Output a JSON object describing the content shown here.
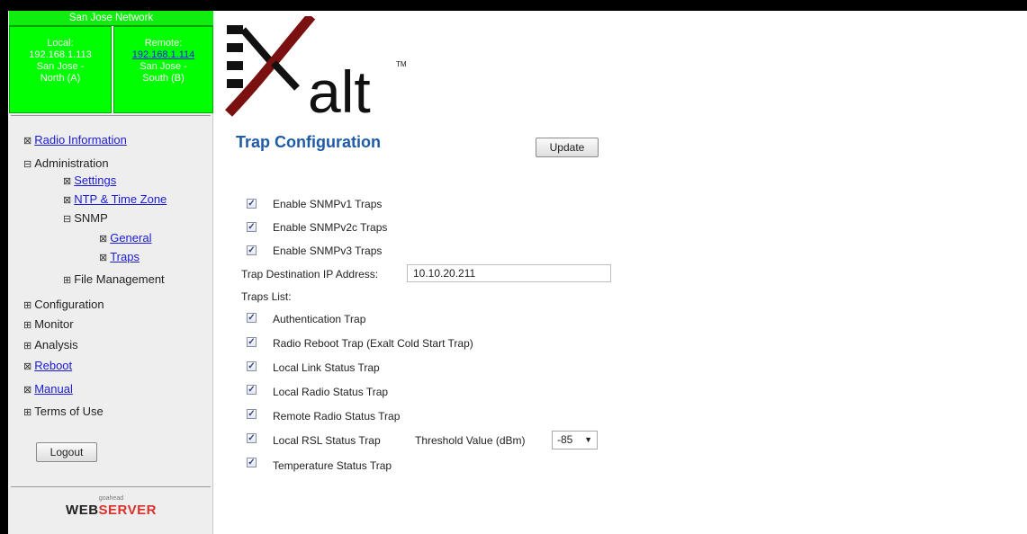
{
  "network": {
    "title": "San Jose Network",
    "local_label": "Local:",
    "local_ip": "192.168.1.113",
    "local_name_1": "San Jose -",
    "local_name_2": "North (A)",
    "remote_label": "Remote:",
    "remote_ip": "192.168.1.114",
    "remote_name_1": "San Jose -",
    "remote_name_2": "South (B)"
  },
  "nav": {
    "radio_information": "Radio Information",
    "administration": "Administration",
    "settings": "Settings",
    "ntp_time_zone": "NTP & Time Zone",
    "snmp": "SNMP",
    "general": "General",
    "traps": "Traps",
    "file_management": "File Management",
    "configuration": "Configuration",
    "monitor": "Monitor",
    "analysis": "Analysis",
    "reboot": "Reboot",
    "manual": "Manual",
    "terms_of_use": "Terms of Use",
    "icons": {
      "leaf": "⊠",
      "expanded": "⊟",
      "collapsed": "⊞"
    }
  },
  "logout_label": "Logout",
  "footer_logo": {
    "small": "goahead",
    "part1": "WEB",
    "part2": "SERVER"
  },
  "brand": {
    "name": "alt",
    "tm": "TM"
  },
  "page": {
    "title": "Trap Configuration",
    "update_label": "Update",
    "snmp_versions": [
      {
        "label": "Enable SNMPv1 Traps",
        "checked": true
      },
      {
        "label": "Enable SNMPv2c Traps",
        "checked": true
      },
      {
        "label": "Enable SNMPv3 Traps",
        "checked": true
      }
    ],
    "trap_dest_label": "Trap Destination IP Address:",
    "trap_dest_value": "10.10.20.211",
    "traps_list_label": "Traps List:",
    "traps": [
      {
        "label": "Authentication Trap",
        "checked": true
      },
      {
        "label": "Radio Reboot Trap (Exalt Cold Start Trap)",
        "checked": true
      },
      {
        "label": "Local Link Status Trap",
        "checked": true
      },
      {
        "label": "Local Radio Status Trap",
        "checked": true
      },
      {
        "label": "Remote Radio Status Trap",
        "checked": true
      },
      {
        "label": "Local RSL Status Trap",
        "checked": true
      },
      {
        "label": "Temperature Status Trap",
        "checked": true
      }
    ],
    "threshold_label": "Threshold Value (dBm)",
    "threshold_value": "-85",
    "check_glyph": "✓"
  },
  "colors": {
    "network_green": "#00ff00",
    "title_blue": "#1f5aa6",
    "link_blue": "#1a1ad8",
    "sidebar_bg": "#eeeeee"
  }
}
